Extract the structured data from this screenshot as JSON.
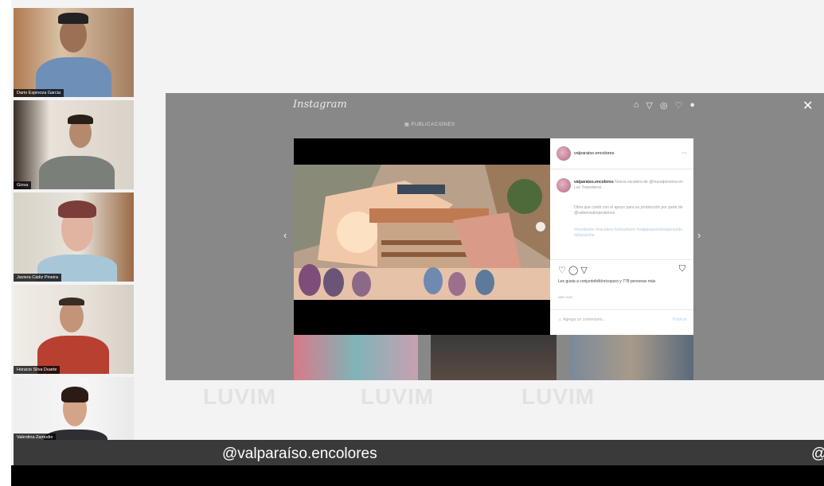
{
  "participants": [
    {
      "name": "Dario Espinoza Garcia"
    },
    {
      "name": "Giova"
    },
    {
      "name": "Javiera Cádiz Pineira"
    },
    {
      "name": "Horacio Silva Duarte"
    },
    {
      "name": "Valentina Zamudio"
    }
  ],
  "watermark": "LUVIM",
  "instagram": {
    "logo": "Instagram",
    "tabs": "▦ PUBLICACIONES",
    "post": {
      "username": "valparaiso.encolores",
      "caption_user": "valparaiso.encolores",
      "caption_text": "Nueva escalera de @muralpersona en Los Torpederos",
      "caption_more": "Obra que contó con el apoyo para su producción por parte de @valeenvalorpeatones",
      "hashtags": "#muralismo #escalera #arteurbano #valparaisotodospenando #playancha",
      "likes_text": "Les gusta a conjuntofolkloricopuro y 778 personas más",
      "comment_placeholder": "Agrega un comentario...",
      "publish_label": "Publicar"
    }
  },
  "caption": {
    "handle": "@valparaíso.encolores",
    "edge": "@"
  },
  "icons": {
    "close": "close-icon",
    "home": "home-icon",
    "send": "send-icon",
    "explore": "compass-icon",
    "heart": "heart-icon",
    "profile": "profile-icon"
  }
}
